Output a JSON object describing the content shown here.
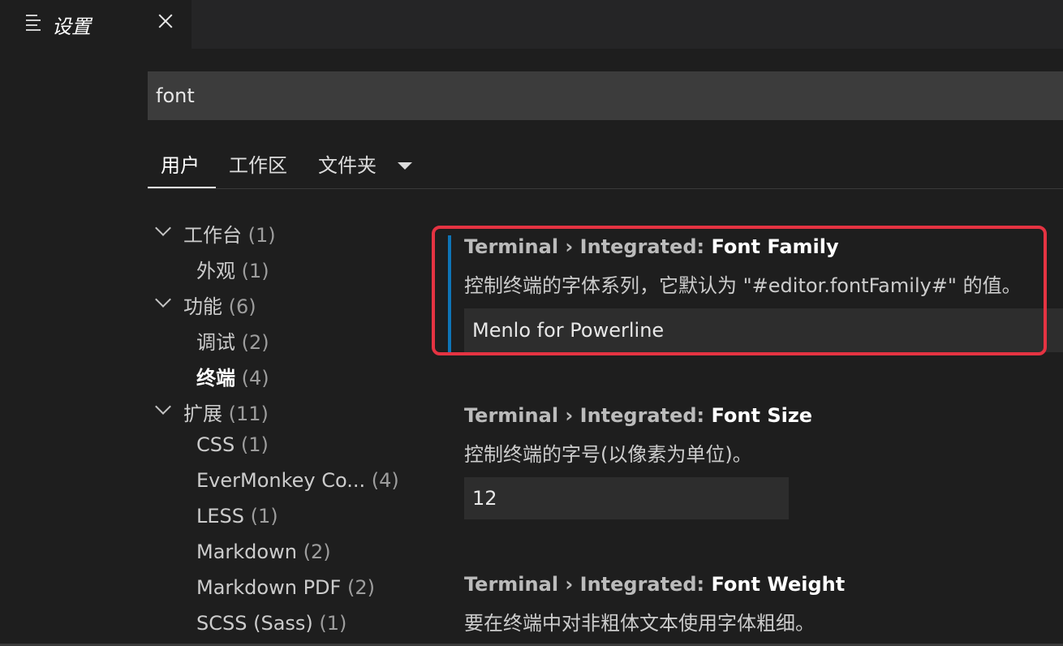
{
  "tab": {
    "title": "设置",
    "icon": "settings-list-icon",
    "close_icon": "close-icon"
  },
  "search": {
    "value": "font"
  },
  "scopes": {
    "user": "用户",
    "workspace": "工作区",
    "folder": "文件夹"
  },
  "toc": [
    {
      "label": "工作台",
      "count": "(1)"
    },
    {
      "label": "外观",
      "count": "(1)"
    },
    {
      "label": "功能",
      "count": "(6)"
    },
    {
      "label": "调试",
      "count": "(2)"
    },
    {
      "label": "终端",
      "count": "(4)"
    },
    {
      "label": "扩展",
      "count": "(11)"
    },
    {
      "label": "CSS",
      "count": "(1)"
    },
    {
      "label": "EverMonkey Co...",
      "count": "(4)"
    },
    {
      "label": "LESS",
      "count": "(1)"
    },
    {
      "label": "Markdown",
      "count": "(2)"
    },
    {
      "label": "Markdown PDF",
      "count": "(2)"
    },
    {
      "label": "SCSS (Sass)",
      "count": "(1)"
    }
  ],
  "settings": [
    {
      "category": "Terminal › Integrated: ",
      "name": "Font Family",
      "description": "控制终端的字体系列，它默认为 \"#editor.fontFamily#\" 的值。",
      "value": "Menlo for Powerline"
    },
    {
      "category": "Terminal › Integrated: ",
      "name": "Font Size",
      "description": "控制终端的字号(以像素为单位)。",
      "value": "12"
    },
    {
      "category": "Terminal › Integrated: ",
      "name": "Font Weight",
      "description": "要在终端中对非粗体文本使用字体粗细。"
    }
  ],
  "colors": {
    "accent": "#0e74b6",
    "highlight": "#e53342",
    "background": "#1e1e1e"
  }
}
